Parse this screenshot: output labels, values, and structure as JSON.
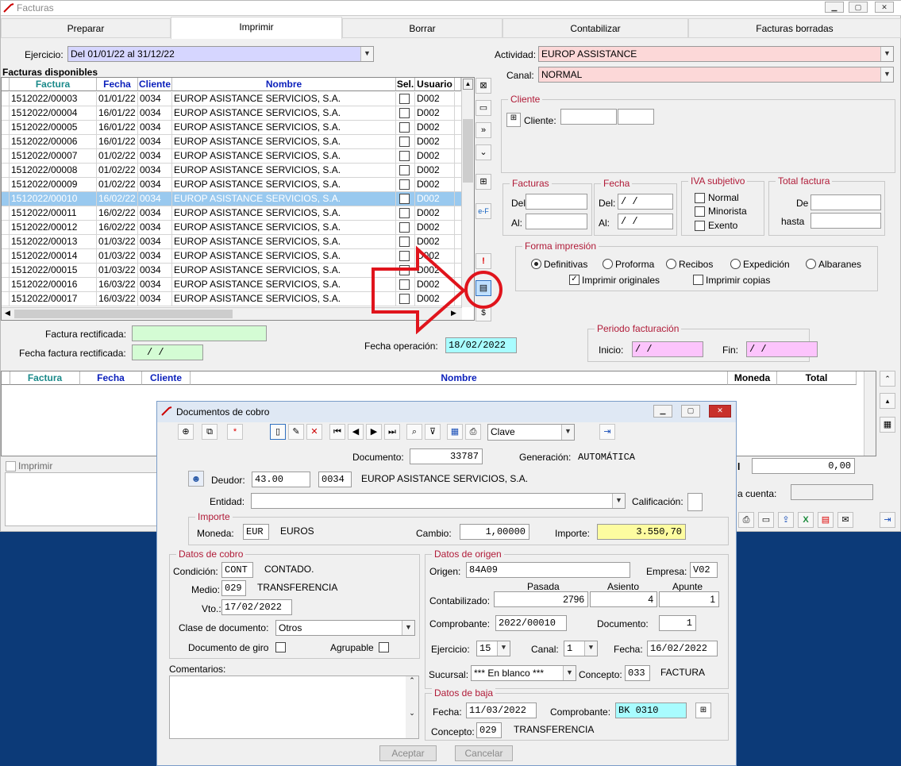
{
  "window": {
    "title": "Facturas"
  },
  "tabs": [
    "Preparar",
    "Imprimir",
    "Borrar",
    "Contabilizar",
    "Facturas borradas"
  ],
  "ejercicio": {
    "label": "Ejercicio:",
    "value": "Del 01/01/22 al 31/12/22"
  },
  "actividad": {
    "label": "Actividad:",
    "value": "EUROP ASSISTANCE"
  },
  "canal": {
    "label": "Canal:",
    "value": "NORMAL"
  },
  "facturas_disponibles": {
    "title": "Facturas disponibles",
    "headers": [
      "Factura",
      "Fecha",
      "Cliente",
      "Nombre",
      "Sel.",
      "Usuario"
    ],
    "rows": [
      [
        "1512022/00003",
        "01/01/22",
        "0034",
        "EUROP ASISTANCE SERVICIOS, S.A.",
        "D002"
      ],
      [
        "1512022/00004",
        "16/01/22",
        "0034",
        "EUROP ASISTANCE SERVICIOS, S.A.",
        "D002"
      ],
      [
        "1512022/00005",
        "16/01/22",
        "0034",
        "EUROP ASISTANCE SERVICIOS, S.A.",
        "D002"
      ],
      [
        "1512022/00006",
        "16/01/22",
        "0034",
        "EUROP ASISTANCE SERVICIOS, S.A.",
        "D002"
      ],
      [
        "1512022/00007",
        "01/02/22",
        "0034",
        "EUROP ASISTANCE SERVICIOS, S.A.",
        "D002"
      ],
      [
        "1512022/00008",
        "01/02/22",
        "0034",
        "EUROP ASISTANCE SERVICIOS, S.A.",
        "D002"
      ],
      [
        "1512022/00009",
        "01/02/22",
        "0034",
        "EUROP ASISTANCE SERVICIOS, S.A.",
        "D002"
      ],
      [
        "1512022/00010",
        "16/02/22",
        "0034",
        "EUROP ASISTANCE SERVICIOS, S.A.",
        "D002"
      ],
      [
        "1512022/00011",
        "16/02/22",
        "0034",
        "EUROP ASISTANCE SERVICIOS, S.A.",
        "D002"
      ],
      [
        "1512022/00012",
        "16/02/22",
        "0034",
        "EUROP ASISTANCE SERVICIOS, S.A.",
        "D002"
      ],
      [
        "1512022/00013",
        "01/03/22",
        "0034",
        "EUROP ASISTANCE SERVICIOS, S.A.",
        "D002"
      ],
      [
        "1512022/00014",
        "01/03/22",
        "0034",
        "EUROP ASISTANCE SERVICIOS, S.A.",
        "D002"
      ],
      [
        "1512022/00015",
        "01/03/22",
        "0034",
        "EUROP ASISTANCE SERVICIOS, S.A.",
        "D002"
      ],
      [
        "1512022/00016",
        "16/03/22",
        "0034",
        "EUROP ASISTANCE SERVICIOS, S.A.",
        "D002"
      ],
      [
        "1512022/00017",
        "16/03/22",
        "0034",
        "EUROP ASISTANCE SERVICIOS, S.A.",
        "D002"
      ]
    ],
    "selected_row": 7
  },
  "cliente": {
    "group": "Cliente",
    "label": "Cliente:"
  },
  "facturas_grp": {
    "group": "Facturas",
    "del": "Del:",
    "al": "Al:"
  },
  "fecha_grp": {
    "group": "Fecha",
    "del": "Del:",
    "al": "Al:",
    "del_val": "/ /",
    "al_val": "/ /"
  },
  "iva": {
    "group": "IVA subjetivo",
    "opts": [
      "Normal",
      "Minorista",
      "Exento"
    ]
  },
  "total": {
    "group": "Total factura",
    "de": "De",
    "hasta": "hasta"
  },
  "forma": {
    "group": "Forma impresión",
    "opts": [
      "Definitivas",
      "Proforma",
      "Recibos",
      "Expedición",
      "Albaranes"
    ],
    "originales": "Imprimir originales",
    "copias": "Imprimir copias"
  },
  "rect": {
    "label": "Factura rectificada:",
    "fecha_label": "Fecha factura rectificada:",
    "fecha_val": "/  /"
  },
  "fecha_op": {
    "label": "Fecha operación:",
    "value": "18/02/2022"
  },
  "periodo": {
    "group": "Periodo facturación",
    "inicio": "Inicio:",
    "fin": "Fin:",
    "inicio_val": "/ /",
    "fin_val": "/ /"
  },
  "bottom_grid": {
    "headers": [
      "Factura",
      "Fecha",
      "Cliente",
      "Nombre",
      "Moneda",
      "Total"
    ]
  },
  "imprimir_chk": "Imprimir",
  "total_val": "0,00",
  "a_cuenta": "a cuenta:",
  "dialog": {
    "title": "Documentos de cobro",
    "clave": "Clave",
    "documento_label": "Documento:",
    "documento": "33787",
    "generacion_label": "Generación:",
    "generacion": "AUTOMÁTICA",
    "deudor_label": "Deudor:",
    "deudor_cta": "43.00",
    "deudor_cod": "0034",
    "deudor_nombre": "EUROP ASISTANCE SERVICIOS, S.A.",
    "entidad_label": "Entidad:",
    "calificacion_label": "Calificación:",
    "importe_grp": "Importe",
    "moneda_label": "Moneda:",
    "moneda": "EUR",
    "moneda_nombre": "EUROS",
    "cambio_label": "Cambio:",
    "cambio": "1,00000",
    "importe_label": "Importe:",
    "importe": "3.550,70",
    "cobro_grp": "Datos de cobro",
    "condicion_label": "Condición:",
    "condicion": "CONT",
    "condicion_nombre": "CONTADO.",
    "medio_label": "Medio:",
    "medio": "029",
    "medio_nombre": "TRANSFERENCIA",
    "vto_label": "Vto.:",
    "vto": "17/02/2022",
    "clase_label": "Clase de documento:",
    "clase": "Otros",
    "giro_label": "Documento de giro",
    "agrupable_label": "Agrupable",
    "comentarios_label": "Comentarios:",
    "origen_grp": "Datos de origen",
    "origen_label": "Origen:",
    "origen": "84A09",
    "empresa_label": "Empresa:",
    "empresa": "V02",
    "pasada_label": "Pasada",
    "asiento_label": "Asiento",
    "apunte_label": "Apunte",
    "contabilizado_label": "Contabilizado:",
    "pasada": "2796",
    "asiento": "4",
    "apunte": "1",
    "comprobante_label": "Comprobante:",
    "comprobante": "2022/00010",
    "documento2_label": "Documento:",
    "documento2": "1",
    "ejercicio_label": "Ejercicio:",
    "ejercicio": "15",
    "canal_label": "Canal:",
    "canal": "1",
    "fecha_label": "Fecha:",
    "fecha": "16/02/2022",
    "sucursal_label": "Sucursal:",
    "sucursal": "*** En blanco ***",
    "concepto_label": "Concepto:",
    "concepto": "033",
    "concepto_nombre": "FACTURA",
    "baja_grp": "Datos de baja",
    "baja_fecha_label": "Fecha:",
    "baja_fecha": "11/03/2022",
    "baja_comprobante_label": "Comprobante:",
    "baja_comprobante": "BK  0310",
    "baja_concepto_label": "Concepto:",
    "baja_concepto": "029",
    "baja_concepto_nombre": "TRANSFERENCIA",
    "aceptar": "Aceptar",
    "cancelar": "Cancelar"
  },
  "colors": {
    "pink": "#fcd8d8",
    "lavender": "#d6d6ff",
    "green": "#d4fcd4",
    "cyan": "#a8fcff",
    "magenta": "#fcc4fc",
    "yellow": "#fdfca0",
    "annotation": "#e0141c"
  }
}
